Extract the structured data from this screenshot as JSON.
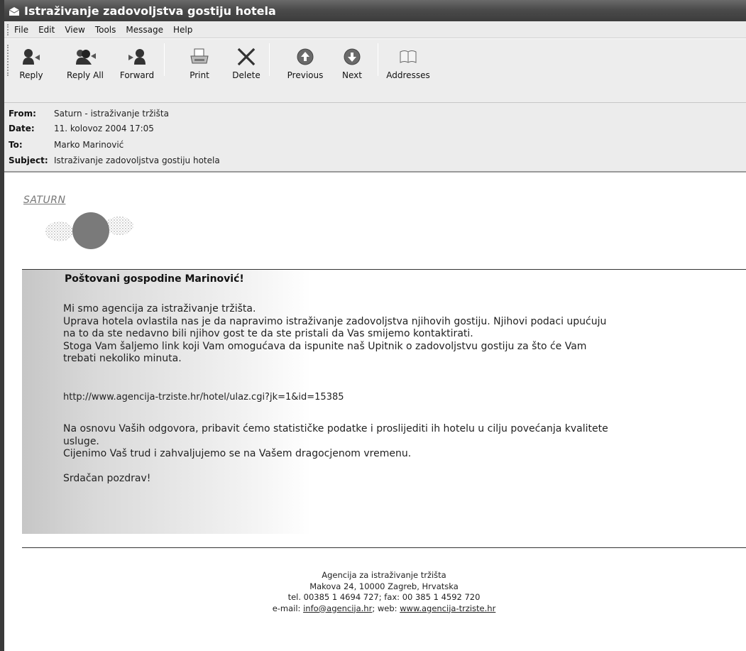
{
  "window": {
    "title": "Istraživanje zadovoljstva gostiju hotela"
  },
  "menu": {
    "items": [
      {
        "key": "file",
        "label": "File"
      },
      {
        "key": "edit",
        "label": "Edit"
      },
      {
        "key": "view",
        "label": "View"
      },
      {
        "key": "tools",
        "label": "Tools"
      },
      {
        "key": "message",
        "label": "Message"
      },
      {
        "key": "help",
        "label": "Help"
      }
    ]
  },
  "toolbar": {
    "reply": "Reply",
    "reply_all": "Reply All",
    "forward": "Forward",
    "print": "Print",
    "delete": "Delete",
    "previous": "Previous",
    "next": "Next",
    "addresses": "Addresses"
  },
  "header": {
    "from_label": "From:",
    "from": "Saturn - istraživanje tržišta",
    "date_label": "Date:",
    "date": "11. kolovoz 2004 17:05",
    "to_label": "To:",
    "to": "Marko Marinović",
    "subject_label": "Subject:",
    "subject": "Istraživanje zadovoljstva gostiju hotela"
  },
  "body": {
    "logo_text": "SATURN",
    "greeting": "Poštovani gospodine Marinović!",
    "para1": "Mi smo agencija za istraživanje tržišta.\nUprava hotela ovlastila nas je da napravimo istraživanje zadovoljstva njihovih gostiju. Njihovi podaci upućuju\nna to da ste nedavno bili njihov gost te da ste pristali da Vas smijemo kontaktirati.\nStoga Vam šaljemo link koji Vam omogućava da ispunite naš Upitnik o zadovoljstvu gostiju za što će Vam\ntrebati nekoliko minuta.",
    "link": "http://www.agencija-trziste.hr/hotel/ulaz.cgi?jk=1&id=15385",
    "para2": "Na osnovu Vaših odgovora, pribavit ćemo statističke podatke i proslijediti ih hotelu u cilju povećanja kvalitete\nusluge.\nCijenimo Vaš trud i zahvaljujemo se na Vašem dragocjenom vremenu.",
    "closing": "Srdačan pozdrav!"
  },
  "footer": {
    "line1": "Agencija za istraživanje tržišta",
    "line2": "Makova 24, 10000 Zagreb, Hrvatska",
    "line3": "tel. 00385 1 4694 727; fax: 00 385 1 4592 720",
    "email_prefix": "e-mail: ",
    "email": "info@agencija.hr",
    "web_prefix": "; web: ",
    "web": "www.agencija-trziste.hr"
  }
}
